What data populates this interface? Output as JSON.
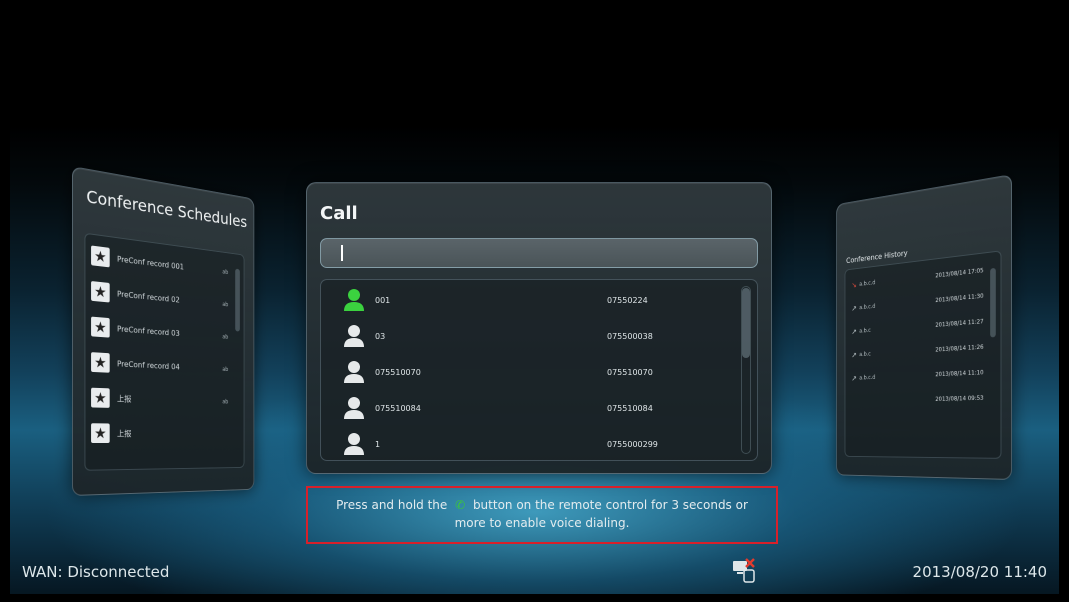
{
  "schedules": {
    "title": "Conference Schedules",
    "items": [
      {
        "name": "PreConf record 001",
        "meta": "ab"
      },
      {
        "name": "PreConf record 02",
        "meta": "ab"
      },
      {
        "name": "PreConf record 03",
        "meta": "ab"
      },
      {
        "name": "PreConf record 04",
        "meta": "ab"
      },
      {
        "name": "上报",
        "meta": "ab"
      },
      {
        "name": "上报",
        "meta": ""
      }
    ]
  },
  "call": {
    "title": "Call",
    "input_value": "",
    "contacts": [
      {
        "name": "001",
        "number": "07550224",
        "status_color": "#3bd23f"
      },
      {
        "name": "03",
        "number": "075500038",
        "status_color": "#e6e9ea"
      },
      {
        "name": "075510070",
        "number": "075510070",
        "status_color": "#e6e9ea"
      },
      {
        "name": "075510084",
        "number": "075510084",
        "status_color": "#e6e9ea"
      },
      {
        "name": "1",
        "number": "0755000299",
        "status_color": "#e6e9ea"
      }
    ]
  },
  "history": {
    "title": "Conference History",
    "items": [
      {
        "name": "a.b.c.d",
        "time": "2013/08/14 17:05",
        "icon": "missed-call-icon"
      },
      {
        "name": "a.b.c.d",
        "time": "2013/08/14 11:30",
        "icon": "outgoing-call-icon"
      },
      {
        "name": "a.b.c",
        "time": "2013/08/14 11:27",
        "icon": "outgoing-call-icon"
      },
      {
        "name": "a.b.c",
        "time": "2013/08/14 11:26",
        "icon": "outgoing-call-icon"
      },
      {
        "name": "a.b.c.d",
        "time": "2013/08/14 11:10",
        "icon": "outgoing-call-icon"
      },
      {
        "name": "",
        "time": "2013/08/14 09:53",
        "icon": ""
      }
    ]
  },
  "tip": {
    "line1_before": "Press and hold the",
    "line1_after": "button on the remote control for 3 seconds or",
    "line2": "more to enable voice dialing."
  },
  "status": {
    "wan": "WAN: Disconnected",
    "datetime": "2013/08/20 11:40",
    "network_icon": "network-disconnected-icon"
  },
  "colors": {
    "accent_green": "#3ac63c",
    "highlight_red": "#d8202a"
  }
}
